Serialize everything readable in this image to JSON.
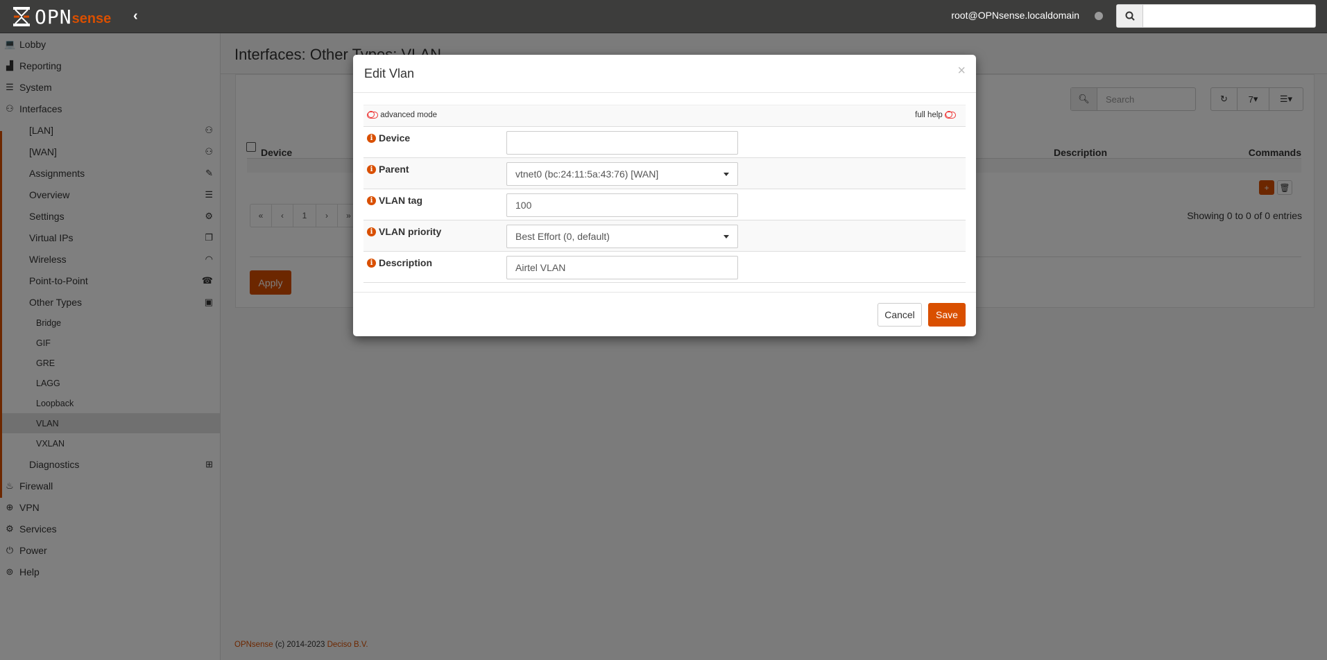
{
  "topbar": {
    "logo_text": "OPNsense",
    "user": "root@OPNsense.localdomain",
    "search_value": ""
  },
  "sidebar": {
    "items": [
      {
        "label": "Lobby",
        "icon": "laptop-icon",
        "glyph": "💻",
        "level": "top"
      },
      {
        "label": "Reporting",
        "icon": "area-chart-icon",
        "glyph": "▟",
        "level": "top"
      },
      {
        "label": "System",
        "icon": "server-icon",
        "glyph": "☰",
        "level": "top"
      },
      {
        "label": "Interfaces",
        "icon": "sitemap-icon",
        "glyph": "⚇",
        "level": "top"
      },
      {
        "label": "[LAN]",
        "icon": "sitemap-icon",
        "glyph": "⚇",
        "level": "sub"
      },
      {
        "label": "[WAN]",
        "icon": "sitemap-icon",
        "glyph": "⚇",
        "level": "sub"
      },
      {
        "label": "Assignments",
        "icon": "pencil-icon",
        "glyph": "✎",
        "level": "sub"
      },
      {
        "label": "Overview",
        "icon": "tasks-icon",
        "glyph": "☰",
        "level": "sub"
      },
      {
        "label": "Settings",
        "icon": "cogs-icon",
        "glyph": "⚙",
        "level": "sub"
      },
      {
        "label": "Virtual IPs",
        "icon": "clone-icon",
        "glyph": "❐",
        "level": "sub"
      },
      {
        "label": "Wireless",
        "icon": "wifi-icon",
        "glyph": "◠",
        "level": "sub"
      },
      {
        "label": "Point-to-Point",
        "icon": "phone-icon",
        "glyph": "☎",
        "level": "sub"
      },
      {
        "label": "Other Types",
        "icon": "archive-icon",
        "glyph": "▣",
        "level": "sub"
      },
      {
        "label": "Bridge",
        "level": "subsub"
      },
      {
        "label": "GIF",
        "level": "subsub"
      },
      {
        "label": "GRE",
        "level": "subsub"
      },
      {
        "label": "LAGG",
        "level": "subsub"
      },
      {
        "label": "Loopback",
        "level": "subsub"
      },
      {
        "label": "VLAN",
        "level": "subsub",
        "active": true
      },
      {
        "label": "VXLAN",
        "level": "subsub"
      },
      {
        "label": "Diagnostics",
        "icon": "medkit-icon",
        "glyph": "⊞",
        "level": "sub"
      },
      {
        "label": "Firewall",
        "icon": "fire-icon",
        "glyph": "♨",
        "level": "top"
      },
      {
        "label": "VPN",
        "icon": "globe-icon",
        "glyph": "⊕",
        "level": "top"
      },
      {
        "label": "Services",
        "icon": "cog-icon",
        "glyph": "⚙",
        "level": "top"
      },
      {
        "label": "Power",
        "icon": "plug-icon",
        "glyph": "⏻",
        "level": "top"
      },
      {
        "label": "Help",
        "icon": "life-ring-icon",
        "glyph": "⊚",
        "level": "top"
      }
    ]
  },
  "main": {
    "title": "Interfaces: Other Types: VLAN",
    "search_placeholder": "Search",
    "page_size": "7",
    "columns": {
      "device": "Device",
      "description": "Description",
      "commands": "Commands"
    },
    "pager": [
      "«",
      "‹",
      "1",
      "›",
      "»"
    ],
    "showing": "Showing 0 to 0 of 0 entries",
    "apply": "Apply"
  },
  "footer": {
    "brand": "OPNsense",
    "copy": " (c) 2014-2023 ",
    "company": "Deciso B.V."
  },
  "modal": {
    "title": "Edit Vlan",
    "close": "×",
    "advanced_mode": "advanced mode",
    "full_help": "full help",
    "fields": [
      {
        "label": "Device",
        "value": "",
        "type": "text"
      },
      {
        "label": "Parent",
        "value": "vtnet0 (bc:24:11:5a:43:76) [WAN]",
        "type": "select"
      },
      {
        "label": "VLAN tag",
        "value": "100",
        "type": "text"
      },
      {
        "label": "VLAN priority",
        "value": "Best Effort (0, default)",
        "type": "select"
      },
      {
        "label": "Description",
        "value": "Airtel VLAN",
        "type": "text"
      }
    ],
    "cancel": "Cancel",
    "save": "Save"
  },
  "colors": {
    "accent": "#d94f00",
    "topbar": "#3d3d3c"
  }
}
